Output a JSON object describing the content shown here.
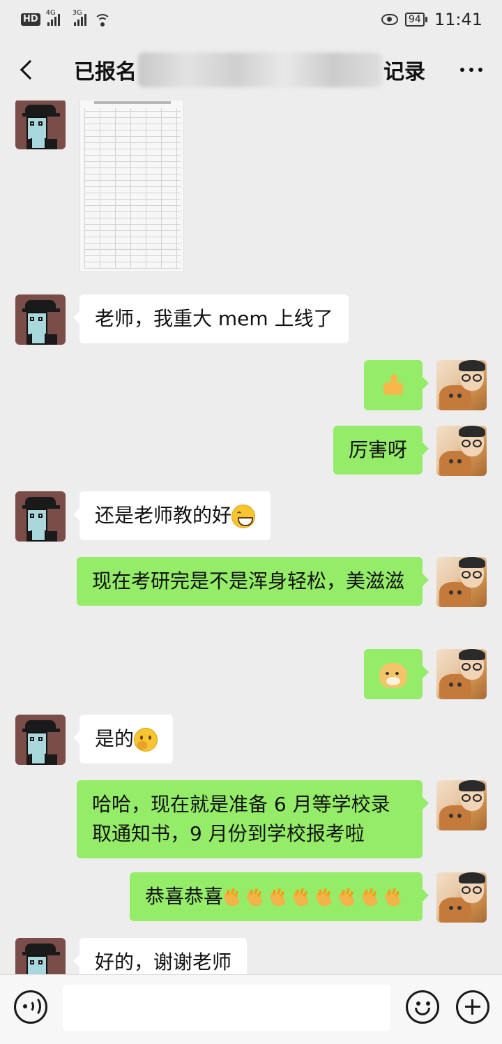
{
  "status_bar": {
    "hd": "HD",
    "signal1_label": "4G",
    "signal2_label": "3G",
    "battery": "94",
    "time": "11:41"
  },
  "header": {
    "title_prefix": "已报名",
    "title_suffix": "记录"
  },
  "messages": [
    {
      "side": "left",
      "type": "image"
    },
    {
      "side": "left",
      "type": "text",
      "text": "老师，我重大 mem 上线了"
    },
    {
      "side": "right",
      "type": "emoji",
      "emoji": "thumbs-up"
    },
    {
      "side": "right",
      "type": "text",
      "text": "厉害呀"
    },
    {
      "side": "left",
      "type": "text",
      "text": "还是老师教的好",
      "emoji": "grin"
    },
    {
      "side": "right",
      "type": "text",
      "text": "现在考研完是不是浑身轻松，美滋滋"
    },
    {
      "side": "right",
      "type": "emoji",
      "emoji": "doge"
    },
    {
      "side": "left",
      "type": "text",
      "text": "是的",
      "emoji": "thinking"
    },
    {
      "side": "right",
      "type": "text",
      "text": "哈哈，现在就是准备 6 月等学校录取通知书，9 月份到学校报考啦"
    },
    {
      "side": "right",
      "type": "text",
      "text": "恭喜恭喜",
      "emoji": "clap",
      "emoji_count": 8
    },
    {
      "side": "left",
      "type": "text",
      "text": "好的，谢谢老师"
    }
  ],
  "input_bar": {
    "placeholder": ""
  },
  "colors": {
    "background": "#ededed",
    "bubble_out": "#95ec69",
    "bubble_in": "#ffffff"
  }
}
